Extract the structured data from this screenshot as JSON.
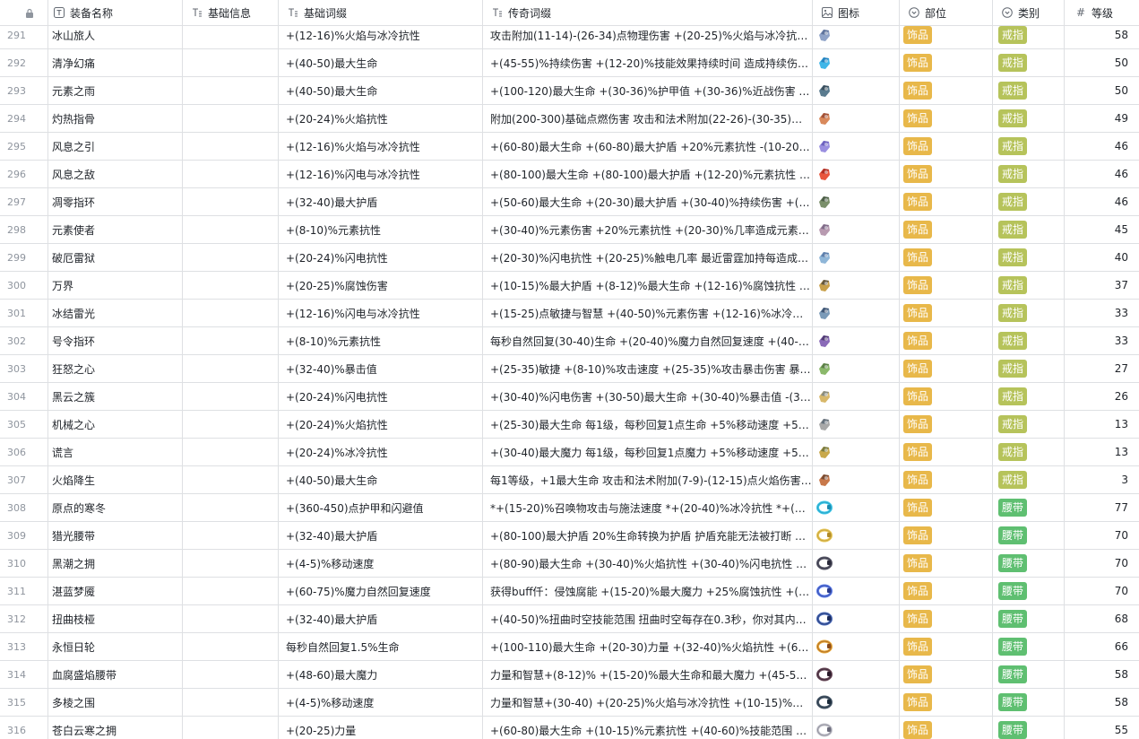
{
  "header": {
    "lock_col": "",
    "name": "装备名称",
    "info": "基础信息",
    "base": "基础词缀",
    "legend": "传奇词缀",
    "icon": "图标",
    "part": "部位",
    "category": "类别",
    "level": "等级"
  },
  "colors": {
    "tag_part": "#e8b84a",
    "tag_ring": "#b6c35b",
    "tag_belt": "#5fbf71"
  },
  "rows": [
    {
      "idx": "291",
      "name": "冰山旅人",
      "base": "+(12-16)%火焰与冰冷抗性",
      "legend": "攻击附加(11-14)-(26-34)点物理伤害 +(20-25)%火焰与冰冷抗性 +(...",
      "part": "饰品",
      "cat": "戒指",
      "lvl": "58",
      "icon": "ring-icon",
      "c1": "#8fa3c8",
      "c2": "#4a5f8a"
    },
    {
      "idx": "292",
      "name": "清净幻痛",
      "base": "+(40-50)最大生命",
      "legend": "+(45-55)%持续伤害 +(12-20)%技能效果持续时间 造成持续伤害时...",
      "part": "饰品",
      "cat": "戒指",
      "lvl": "50",
      "icon": "ring-icon",
      "c1": "#3fb6e8",
      "c2": "#1c6fb0"
    },
    {
      "idx": "293",
      "name": "元素之雨",
      "base": "+(40-50)最大生命",
      "legend": "+(100-120)最大生命 +(30-36)%护甲值 +(30-36)%近战伤害 每有1...",
      "part": "饰品",
      "cat": "戒指",
      "lvl": "50",
      "icon": "ring-icon",
      "c1": "#5a7b8f",
      "c2": "#2d3e4a"
    },
    {
      "idx": "294",
      "name": "灼热指骨",
      "base": "+(20-24)%火焰抗性",
      "legend": "附加(200-300)基础点燃伤害 攻击和法术附加(22-26)-(30-35)点火焰...",
      "part": "饰品",
      "cat": "戒指",
      "lvl": "49",
      "icon": "ring-icon",
      "c1": "#d9895b",
      "c2": "#8a3b2a"
    },
    {
      "idx": "295",
      "name": "风息之引",
      "base": "+(12-16)%火焰与冰冷抗性",
      "legend": "+(60-80)最大生命 +(60-80)最大护盾 +20%元素抗性 -(10-20)%移...",
      "part": "饰品",
      "cat": "戒指",
      "lvl": "46",
      "icon": "ring-icon",
      "c1": "#9a8fe0",
      "c2": "#5a4fb0"
    },
    {
      "idx": "296",
      "name": "风息之敌",
      "base": "+(12-16)%闪电与冰冷抗性",
      "legend": "+(80-100)最大生命 +(80-100)最大护盾 +(12-20)%元素抗性 -20%...",
      "part": "饰品",
      "cat": "戒指",
      "lvl": "46",
      "icon": "ring-icon",
      "c1": "#e8553c",
      "c2": "#9a1f1a"
    },
    {
      "idx": "297",
      "name": "凋零指环",
      "base": "+(32-40)最大护盾",
      "legend": "+(50-60)最大生命 +(20-30)最大护盾 +(30-40)%持续伤害 +(10-50)...",
      "part": "饰品",
      "cat": "戒指",
      "lvl": "46",
      "icon": "ring-icon",
      "c1": "#7a8f6a",
      "c2": "#3a4a3a"
    },
    {
      "idx": "298",
      "name": "元素使者",
      "base": "+(8-10)%元素抗性",
      "legend": "+(30-40)%元素伤害 +20%元素抗性 +(20-30)%几率造成元素异常...",
      "part": "饰品",
      "cat": "戒指",
      "lvl": "45",
      "icon": "ring-icon",
      "c1": "#b89ab0",
      "c2": "#6a5a7a"
    },
    {
      "idx": "299",
      "name": "破厄雷狱",
      "base": "+(20-24)%闪电抗性",
      "legend": "+(20-30)%闪电抗性 +(20-25)%触电几率 最近雷霆加持每造成一次...",
      "part": "饰品",
      "cat": "戒指",
      "lvl": "40",
      "icon": "ring-icon",
      "c1": "#8fb6d8",
      "c2": "#4a6a9a"
    },
    {
      "idx": "300",
      "name": "万界",
      "base": "+(20-25)%腐蚀伤害",
      "legend": "+(10-15)%最大护盾 +(8-12)%最大生命 +(12-16)%腐蚀抗性 附加(8...",
      "part": "饰品",
      "cat": "戒指",
      "lvl": "37",
      "icon": "ring-icon",
      "c1": "#c8a04a",
      "c2": "#3a3a3a"
    },
    {
      "idx": "301",
      "name": "冰结雷光",
      "base": "+(12-16)%闪电与冰冷抗性",
      "legend": "+(15-25)点敏捷与智慧 +(40-50)%元素伤害 +(12-16)%冰冷与闪电...",
      "part": "饰品",
      "cat": "戒指",
      "lvl": "33",
      "icon": "ring-icon",
      "c1": "#7a9ab8",
      "c2": "#2a3a5a"
    },
    {
      "idx": "302",
      "name": "号令指环",
      "base": "+(8-10)%元素抗性",
      "legend": "每秒自然回复(30-40)生命 +(20-40)%魔力自然回复速度 +(40-50)%...",
      "part": "饰品",
      "cat": "戒指",
      "lvl": "33",
      "icon": "ring-icon",
      "c1": "#8a6ab8",
      "c2": "#3a2a5a"
    },
    {
      "idx": "303",
      "name": "狂怒之心",
      "base": "+(32-40)%暴击值",
      "legend": "+(25-35)敏捷 +(8-10)%攻击速度 +(25-35)%攻击暴击伤害 暴击时...",
      "part": "饰品",
      "cat": "戒指",
      "lvl": "27",
      "icon": "ring-icon",
      "c1": "#8ab86a",
      "c2": "#4a6a3a"
    },
    {
      "idx": "304",
      "name": "黑云之簇",
      "base": "+(20-24)%闪电抗性",
      "legend": "+(30-40)%闪电伤害 +(30-50)最大生命 +(30-40)%暴击值 -(30-40)%...",
      "part": "饰品",
      "cat": "戒指",
      "lvl": "26",
      "icon": "ring-icon",
      "c1": "#d8b86a",
      "c2": "#6a7a8a"
    },
    {
      "idx": "305",
      "name": "机械之心",
      "base": "+(20-24)%火焰抗性",
      "legend": "+(25-30)最大生命 每1级，每秒回复1点生命 +5%移动速度 +5%攻...",
      "part": "饰品",
      "cat": "戒指",
      "lvl": "13",
      "icon": "ring-icon",
      "c1": "#a8a8a8",
      "c2": "#4a5a6a"
    },
    {
      "idx": "306",
      "name": "谎言",
      "base": "+(20-24)%冰冷抗性",
      "legend": "+(30-40)最大魔力 每1级，每秒回复1点魔力 +5%移动速度 +5%施...",
      "part": "饰品",
      "cat": "戒指",
      "lvl": "13",
      "icon": "ring-icon",
      "c1": "#c8a84a",
      "c2": "#5a6a3a"
    },
    {
      "idx": "307",
      "name": "火焰降生",
      "base": "+(40-50)最大生命",
      "legend": "每1等级，+1最大生命 攻击和法术附加(7-9)-(12-15)点火焰伤害 +(...",
      "part": "饰品",
      "cat": "戒指",
      "lvl": "3",
      "icon": "ring-icon",
      "c1": "#c8784a",
      "c2": "#5a3a2a"
    },
    {
      "idx": "308",
      "name": "原点的寒冬",
      "base": "+(360-450)点护甲和闪避值",
      "legend": "*+(15-20)%召唤物攻击与施法速度 *+(20-40)%冰冷抗性 *+(8-12)%...",
      "part": "饰品",
      "cat": "腰带",
      "lvl": "77",
      "icon": "belt-icon",
      "c1": "#3fc8e8",
      "c2": "#1c8ab0"
    },
    {
      "idx": "309",
      "name": "猎光腰带",
      "base": "+(32-40)最大护盾",
      "legend": "+(80-100)最大护盾 20%生命转换为护盾 护盾充能无法被打断 当前...",
      "part": "饰品",
      "cat": "腰带",
      "lvl": "70",
      "icon": "belt-icon",
      "c1": "#e8c85a",
      "c2": "#b08a2a"
    },
    {
      "idx": "310",
      "name": "黑潮之拥",
      "base": "+(4-5)%移动速度",
      "legend": "+(80-90)最大生命 +(30-40)%火焰抗性 +(30-40)%闪电抗性 被触电...",
      "part": "饰品",
      "cat": "腰带",
      "lvl": "70",
      "icon": "belt-icon",
      "c1": "#5a5a6a",
      "c2": "#2a2a3a"
    },
    {
      "idx": "311",
      "name": "湛蓝梦魇",
      "base": "+(60-75)%魔力自然回复速度",
      "legend": "获得buff仟：侵蚀腐能 +(15-20)%最大魔力 +25%腐蚀抗性 +(40-60)...",
      "part": "饰品",
      "cat": "腰带",
      "lvl": "70",
      "icon": "belt-icon",
      "c1": "#5a7ae8",
      "c2": "#2a3a8a"
    },
    {
      "idx": "312",
      "name": "扭曲枝桠",
      "base": "+(32-40)最大护盾",
      "legend": "+(40-50)%扭曲时空技能范围 扭曲时空每存在0.3秒，你对其内的敌...",
      "part": "饰品",
      "cat": "腰带",
      "lvl": "68",
      "icon": "belt-icon",
      "c1": "#4a6ab8",
      "c2": "#1a2a5a"
    },
    {
      "idx": "313",
      "name": "永恒日轮",
      "base": "每秒自然回复1.5%生命",
      "legend": "+(100-110)最大生命 +(20-30)力量 +(32-40)%火焰抗性 +(64-83)%...",
      "part": "饰品",
      "cat": "腰带",
      "lvl": "66",
      "icon": "belt-icon",
      "c1": "#e8a83a",
      "c2": "#8a4a1a"
    },
    {
      "idx": "314",
      "name": "血腐盛焰腰带",
      "base": "+(48-60)最大魔力",
      "legend": "力量和智慧+(8-12)% +(15-20)%最大生命和最大魔力 +(45-55)%腐...",
      "part": "饰品",
      "cat": "腰带",
      "lvl": "58",
      "icon": "belt-icon",
      "c1": "#6a4a5a",
      "c2": "#2a1a2a"
    },
    {
      "idx": "315",
      "name": "多棱之围",
      "base": "+(4-5)%移动速度",
      "legend": "力量和智慧+(30-40) +(20-25)%火焰与冰冷抗性 +(10-15)%攻击与...",
      "part": "饰品",
      "cat": "腰带",
      "lvl": "58",
      "icon": "belt-icon",
      "c1": "#4a5a6a",
      "c2": "#1a2a3a"
    },
    {
      "idx": "316",
      "name": "苍白云寒之拥",
      "base": "+(20-25)力量",
      "legend": "+(60-80)最大生命 +(10-15)%元素抗性 +(40-60)%技能范围 技能范...",
      "part": "饰品",
      "cat": "腰带",
      "lvl": "55",
      "icon": "belt-icon",
      "c1": "#c8c8d0",
      "c2": "#6a6a7a"
    }
  ]
}
